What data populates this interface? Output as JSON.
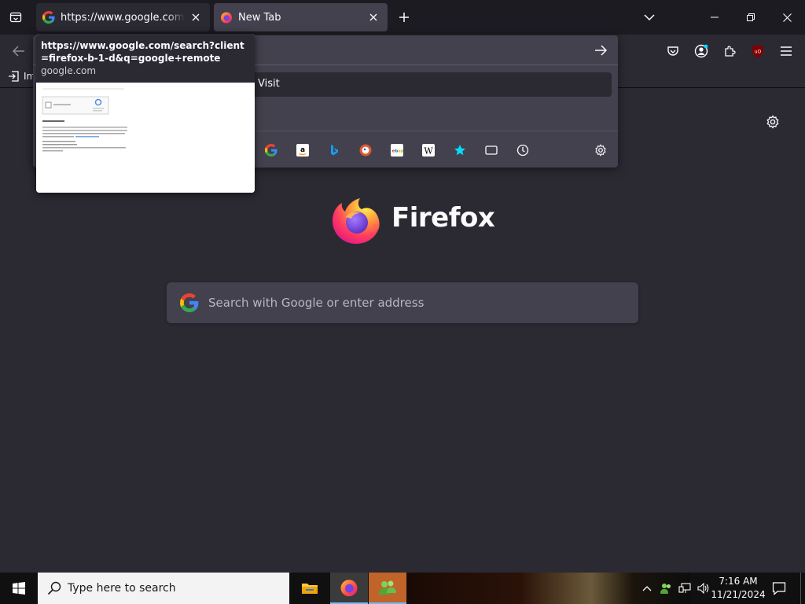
{
  "tabs": [
    {
      "title": "https://www.google.com/search?client=firefox-b-1-d&q=google+remote",
      "favicon": "google-g-icon",
      "active": false
    },
    {
      "title": "New Tab",
      "favicon": "firefox-icon",
      "active": true
    }
  ],
  "tab_preview": {
    "title": "https://www.google.com/search?client=firefox-b-1-d&q=google+remote",
    "domain": "google.com"
  },
  "bookmarks": {
    "import_label": "Im"
  },
  "urlbar_popup": {
    "visit_label": "Visit",
    "engines": [
      "google",
      "amazon",
      "bing",
      "duckduckgo",
      "ebay",
      "wikipedia",
      "bookmarks",
      "tabs",
      "history"
    ]
  },
  "newtab": {
    "wordmark": "Firefox",
    "search_placeholder": "Search with Google or enter address"
  },
  "taskbar": {
    "search_placeholder": "Type here to search",
    "time": "7:16 AM",
    "date": "11/21/2024"
  },
  "colors": {
    "chrome_dark": "#1c1b22",
    "toolbar": "#2b2a33",
    "field": "#42414d",
    "accent": "#00ddff"
  }
}
